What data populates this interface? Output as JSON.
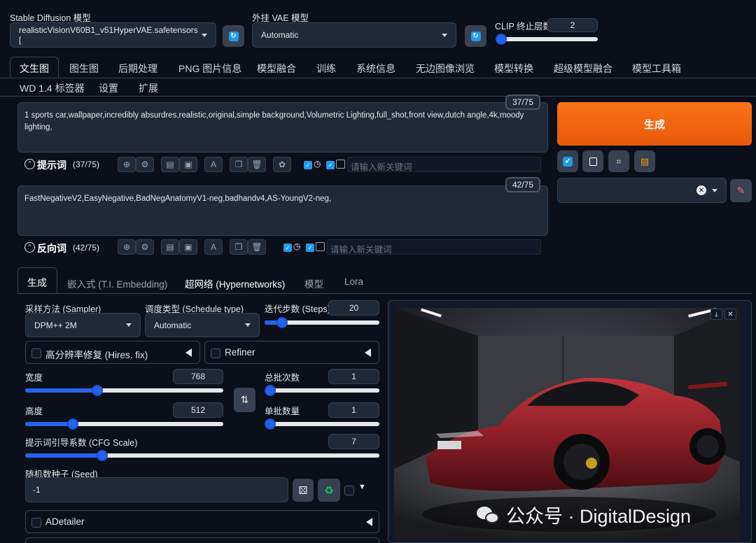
{
  "header": {
    "sd_model_label": "Stable Diffusion 模型",
    "sd_model_value": "realisticVisionV60B1_v51HyperVAE.safetensors [",
    "vae_label": "外挂 VAE 模型",
    "vae_value": "Automatic",
    "clip_label": "CLIP 终止层数",
    "clip_value": "2"
  },
  "tabs_row1": [
    "文生图",
    "图生图",
    "后期处理",
    "PNG 图片信息",
    "模型融合",
    "训练",
    "系统信息",
    "无边图像浏览",
    "模型转换",
    "超级模型融合",
    "模型工具箱"
  ],
  "tabs_row2": [
    "WD 1.4 标签器",
    "设置",
    "扩展"
  ],
  "prompt": {
    "text": "1 sports car,wallpaper,incredibly absurdres,realistic,original,simple background,Volumetric Lighting,full_shot,front view,dutch angle,4k,moody lighting,",
    "counter": "37/75",
    "label": "提示词",
    "label_count": "(37/75)",
    "keyword_placeholder": "请输入新关键词"
  },
  "negative": {
    "text": "FastNegativeV2,EasyNegative,BadNegAnatomyV1-neg,badhandv4,AS-YoungV2-neg,",
    "counter": "42/75",
    "label": "反向词",
    "label_count": "(42/75)",
    "keyword_placeholder": "请输入新关键词"
  },
  "generate_label": "生成",
  "subtabs": [
    "生成",
    "嵌入式 (T.I. Embedding)",
    "超网络 (Hypernetworks)",
    "模型",
    "Lora"
  ],
  "params": {
    "sampler_label": "采样方法 (Sampler)",
    "sampler_value": "DPM++ 2M",
    "schedule_label": "调度类型 (Schedule type)",
    "schedule_value": "Automatic",
    "steps_label": "迭代步数 (Steps)",
    "steps_value": "20",
    "hires_label": "高分辨率修复 (Hires. fix)",
    "refiner_label": "Refiner",
    "width_label": "宽度",
    "width_value": "768",
    "height_label": "高度",
    "height_value": "512",
    "batch_count_label": "总批次数",
    "batch_count_value": "1",
    "batch_size_label": "单批数量",
    "batch_size_value": "1",
    "cfg_label": "提示词引导系数 (CFG Scale)",
    "cfg_value": "7",
    "seed_label": "随机数种子 (Seed)",
    "seed_value": "-1",
    "adetailer_label": "ADetailer"
  },
  "watermark": "公众号 · DigitalDesign",
  "colors": {
    "accent": "#ea580c",
    "blue": "#2563eb",
    "bg": "#0b0f19"
  }
}
